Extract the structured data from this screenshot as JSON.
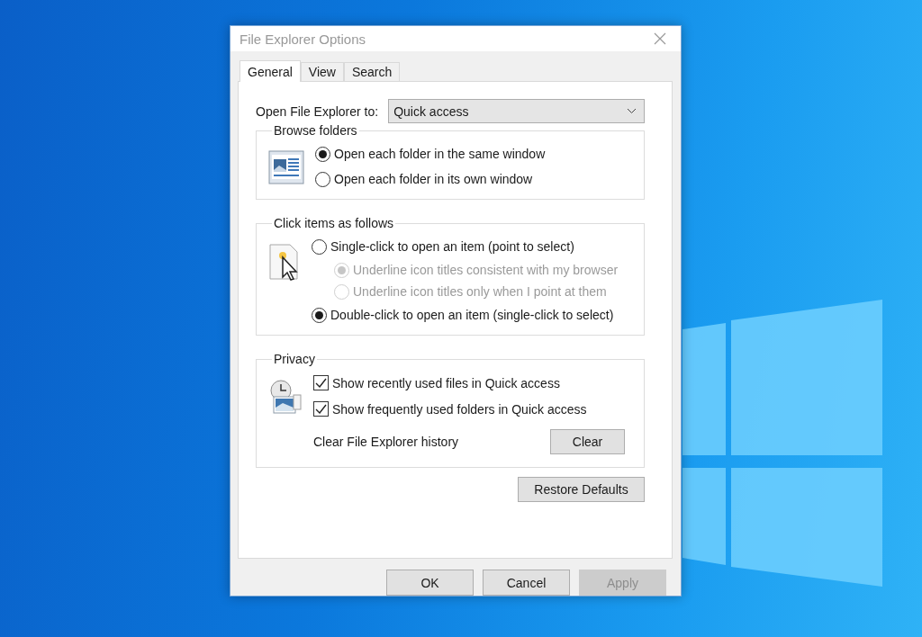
{
  "window": {
    "title": "File Explorer Options"
  },
  "tabs": [
    {
      "label": "General",
      "selected": true
    },
    {
      "label": "View",
      "selected": false
    },
    {
      "label": "Search",
      "selected": false
    }
  ],
  "open_to": {
    "label": "Open File Explorer to:",
    "value": "Quick access"
  },
  "groups": [
    {
      "title": "Browse folders",
      "kind": "browse",
      "items": [
        {
          "kind": "radio",
          "label": "Open each folder in the same window",
          "selected": true,
          "disabled": false
        },
        {
          "kind": "radio",
          "label": "Open each folder in its own window",
          "selected": false,
          "disabled": false
        }
      ]
    },
    {
      "title": "Click items as follows",
      "kind": "click",
      "items": [
        {
          "kind": "radio",
          "label": "Single-click to open an item (point to select)",
          "selected": false,
          "disabled": false,
          "children": [
            {
              "kind": "radio",
              "label": "Underline icon titles consistent with my browser",
              "selected": true,
              "disabled": true
            },
            {
              "kind": "radio",
              "label": "Underline icon titles only when I point at them",
              "selected": false,
              "disabled": true
            }
          ]
        },
        {
          "kind": "radio",
          "label": "Double-click to open an item (single-click to select)",
          "selected": true,
          "disabled": false
        }
      ]
    },
    {
      "title": "Privacy",
      "kind": "privacy",
      "items": [
        {
          "kind": "checkbox",
          "label": "Show recently used files in Quick access",
          "checked": true
        },
        {
          "kind": "checkbox",
          "label": "Show frequently used folders in Quick access",
          "checked": true
        },
        {
          "kind": "action",
          "label": "Clear File Explorer history",
          "button": "Clear"
        }
      ]
    }
  ],
  "restore_button": "Restore Defaults",
  "footer_buttons": [
    {
      "label": "OK",
      "disabled": false
    },
    {
      "label": "Cancel",
      "disabled": false
    },
    {
      "label": "Apply",
      "disabled": true
    }
  ]
}
